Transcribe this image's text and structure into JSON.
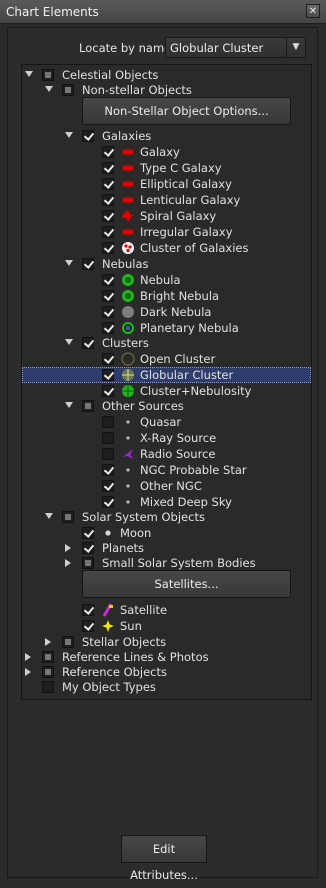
{
  "window": {
    "title": "Chart Elements",
    "close_glyph": "✕"
  },
  "locate": {
    "label": "Locate by name:",
    "value": "Globular Cluster",
    "arrow": "▼"
  },
  "tree": [
    {
      "label": "Celestial Objects",
      "expander": "open",
      "check": "partial",
      "icon": null
    },
    {
      "label": "Non-stellar Objects",
      "expander": "open",
      "check": "partial",
      "icon": null
    },
    {
      "button": "Non-Stellar Object Options..."
    },
    {
      "label": "Galaxies",
      "expander": "open",
      "check": "checked",
      "icon": null
    },
    {
      "label": "Galaxy",
      "expander": null,
      "check": "checked",
      "icon": "galaxy-icon"
    },
    {
      "label": "Type C Galaxy",
      "expander": null,
      "check": "checked",
      "icon": "galaxy-icon"
    },
    {
      "label": "Elliptical Galaxy",
      "expander": null,
      "check": "checked",
      "icon": "galaxy-icon"
    },
    {
      "label": "Lenticular Galaxy",
      "expander": null,
      "check": "checked",
      "icon": "galaxy-icon"
    },
    {
      "label": "Spiral Galaxy",
      "expander": null,
      "check": "checked",
      "icon": "spiral-galaxy-icon"
    },
    {
      "label": "Irregular Galaxy",
      "expander": null,
      "check": "checked",
      "icon": "galaxy-icon"
    },
    {
      "label": "Cluster of Galaxies",
      "expander": null,
      "check": "checked",
      "icon": "galaxy-cluster-icon"
    },
    {
      "label": "Nebulas",
      "expander": "open",
      "check": "checked",
      "icon": null
    },
    {
      "label": "Nebula",
      "expander": null,
      "check": "checked",
      "icon": "nebula-icon"
    },
    {
      "label": "Bright Nebula",
      "expander": null,
      "check": "checked",
      "icon": "nebula-icon"
    },
    {
      "label": "Dark Nebula",
      "expander": null,
      "check": "checked",
      "icon": "dark-nebula-icon"
    },
    {
      "label": "Planetary Nebula",
      "expander": null,
      "check": "checked",
      "icon": "planetary-nebula-icon"
    },
    {
      "label": "Clusters",
      "expander": "open",
      "check": "checked",
      "icon": null
    },
    {
      "label": "Open Cluster",
      "expander": null,
      "check": "checked",
      "icon": "open-cluster-icon"
    },
    {
      "label": "Globular Cluster",
      "expander": null,
      "check": "checked",
      "icon": "globular-cluster-icon",
      "selected": true
    },
    {
      "label": "Cluster+Nebulosity",
      "expander": null,
      "check": "checked",
      "icon": "cluster-nebulosity-icon"
    },
    {
      "label": "Other Sources",
      "expander": "open",
      "check": "partial",
      "icon": null
    },
    {
      "label": "Quasar",
      "expander": null,
      "check": "unchecked",
      "icon": "dot-icon"
    },
    {
      "label": "X-Ray Source",
      "expander": null,
      "check": "unchecked",
      "icon": "dot-icon"
    },
    {
      "label": "Radio Source",
      "expander": null,
      "check": "unchecked",
      "icon": "radio-source-icon"
    },
    {
      "label": "NGC Probable Star",
      "expander": null,
      "check": "checked",
      "icon": "dot-icon"
    },
    {
      "label": "Other NGC",
      "expander": null,
      "check": "checked",
      "icon": "dot-icon"
    },
    {
      "label": "Mixed Deep Sky",
      "expander": null,
      "check": "checked",
      "icon": "dot-icon"
    },
    {
      "label": "Solar System Objects",
      "expander": "open",
      "check": "partial",
      "icon": null
    },
    {
      "label": "Moon",
      "expander": null,
      "check": "checked",
      "icon": "moon-dot-icon"
    },
    {
      "label": "Planets",
      "expander": "closed",
      "check": "checked",
      "icon": null
    },
    {
      "label": "Small Solar System Bodies",
      "expander": "closed",
      "check": "partial",
      "icon": null
    },
    {
      "button": "Satellites..."
    },
    {
      "label": "Satellite",
      "expander": null,
      "check": "checked",
      "icon": "satellite-icon"
    },
    {
      "label": "Sun",
      "expander": null,
      "check": "checked",
      "icon": "sun-icon"
    },
    {
      "label": "Stellar Objects",
      "expander": "closed",
      "check": "partial",
      "icon": null
    },
    {
      "label": "Reference Lines & Photos",
      "expander": "closed",
      "check": "partial",
      "icon": null
    },
    {
      "label": "Reference Objects",
      "expander": "closed",
      "check": "partial",
      "icon": null
    },
    {
      "label": "My Object Types",
      "expander": null,
      "check": "unchecked",
      "icon": null
    }
  ],
  "footer": {
    "edit_button": "Edit Attributes..."
  },
  "colors": {
    "galaxy": "#e00000",
    "nebula": "#22b41e",
    "selection": "#2f3d6c",
    "radio": "#9b28d6",
    "sun": "#f2e600"
  }
}
